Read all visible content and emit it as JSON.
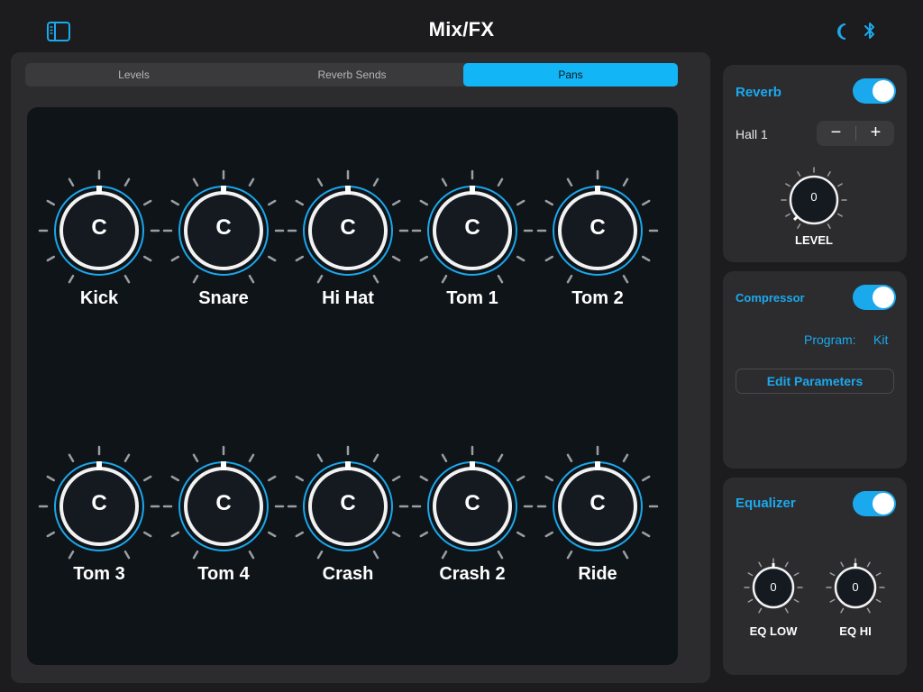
{
  "header": {
    "title": "Mix/FX"
  },
  "icons": {
    "sidebar": "sidebar-icon",
    "moon": "moon-icon",
    "bluetooth": "bluetooth-icon"
  },
  "tabs": [
    {
      "label": "Levels",
      "selected": false
    },
    {
      "label": "Reverb Sends",
      "selected": false
    },
    {
      "label": "Pans",
      "selected": true
    }
  ],
  "pans": [
    {
      "label": "Kick",
      "value": "C"
    },
    {
      "label": "Snare",
      "value": "C"
    },
    {
      "label": "Hi Hat",
      "value": "C"
    },
    {
      "label": "Tom 1",
      "value": "C"
    },
    {
      "label": "Tom 2",
      "value": "C"
    },
    {
      "label": "Tom 3",
      "value": "C"
    },
    {
      "label": "Tom 4",
      "value": "C"
    },
    {
      "label": "Crash",
      "value": "C"
    },
    {
      "label": "Crash 2",
      "value": "C"
    },
    {
      "label": "Ride",
      "value": "C"
    }
  ],
  "reverb": {
    "title": "Reverb",
    "enabled": true,
    "preset": "Hall 1",
    "minus": "−",
    "plus": "+",
    "level_value": "0",
    "level_label": "LEVEL"
  },
  "compressor": {
    "title": "Compressor",
    "enabled": true,
    "program_label": "Program:",
    "program_value": "Kit",
    "edit_label": "Edit Parameters"
  },
  "equalizer": {
    "title": "Equalizer",
    "enabled": true,
    "low_value": "0",
    "low_label": "EQ LOW",
    "hi_value": "0",
    "hi_label": "EQ HI"
  },
  "colors": {
    "accent": "#1ba9ee",
    "tab_active": "#12b5f5",
    "panel": "#0f1419",
    "card": "#2c2c2e"
  }
}
